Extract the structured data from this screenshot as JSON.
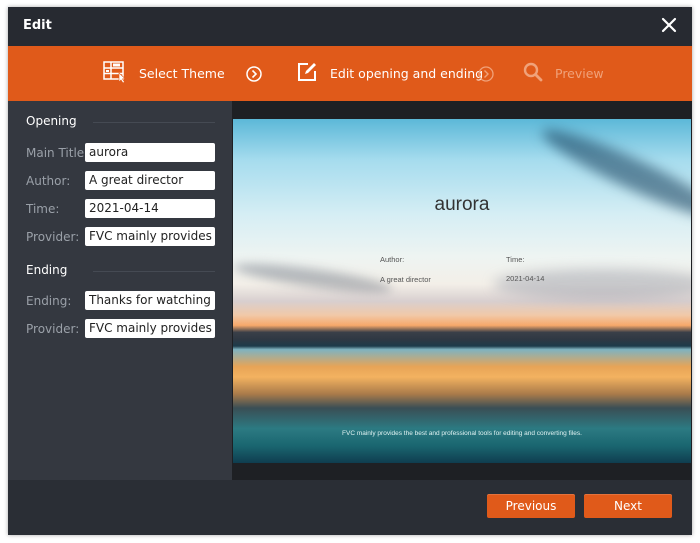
{
  "window": {
    "title": "Edit",
    "close_icon": "close-icon"
  },
  "steps": [
    {
      "label": "Select Theme",
      "icon": "select-theme-icon",
      "state": "done"
    },
    {
      "label": "Edit opening and ending",
      "icon": "edit-icon",
      "state": "active"
    },
    {
      "label": "Preview",
      "icon": "search-icon",
      "state": "inactive"
    }
  ],
  "opening": {
    "heading": "Opening",
    "fields": [
      {
        "label": "Main Title:",
        "value": "aurora"
      },
      {
        "label": "Author:",
        "value": "A great director"
      },
      {
        "label": "Time:",
        "value": "2021-04-14"
      },
      {
        "label": "Provider:",
        "value": "FVC mainly provides the best and professional tools for editing and converting files."
      }
    ]
  },
  "ending": {
    "heading": "Ending",
    "fields": [
      {
        "label": "Ending:",
        "value": "Thanks for watching"
      },
      {
        "label": "Provider:",
        "value": "FVC mainly provides the best and professional tools for editing and converting files."
      }
    ]
  },
  "preview": {
    "title": "aurora",
    "author_label": "Author:",
    "author_value": "A great director",
    "time_label": "Time:",
    "time_value": "2021-04-14",
    "footer": "FVC mainly provides the best and professional tools for editing and converting files."
  },
  "buttons": {
    "previous": "Previous",
    "next": "Next"
  },
  "colors": {
    "accent": "#e05a1a",
    "titlebar": "#272a31",
    "panel": "#343840"
  }
}
